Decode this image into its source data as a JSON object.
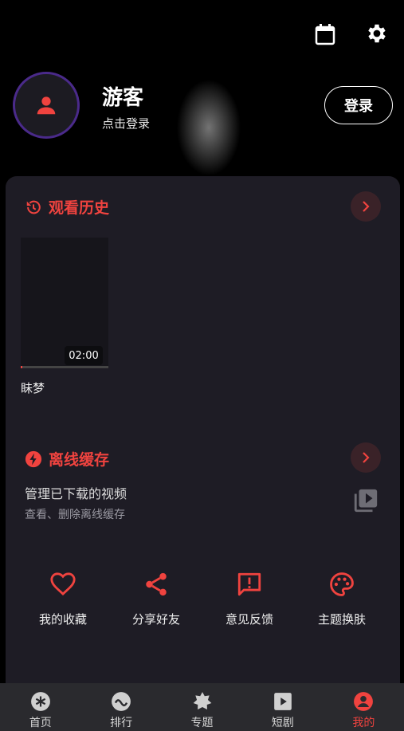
{
  "header": {
    "calendar_icon": "calendar-icon",
    "settings_icon": "gear-icon"
  },
  "profile": {
    "username": "游客",
    "subtitle": "点击登录",
    "login_label": "登录"
  },
  "history": {
    "title": "观看历史",
    "items": [
      {
        "title": "眛梦",
        "duration": "02:00",
        "progress": 0.02
      }
    ]
  },
  "offline": {
    "title": "离线缓存",
    "main_text": "管理已下载的视频",
    "sub_text": "查看、删除离线缓存"
  },
  "actions": [
    {
      "label": "我的收藏",
      "icon": "heart-icon"
    },
    {
      "label": "分享好友",
      "icon": "share-icon"
    },
    {
      "label": "意见反馈",
      "icon": "feedback-icon"
    },
    {
      "label": "主题换肤",
      "icon": "palette-icon"
    }
  ],
  "tabs": [
    {
      "label": "首页",
      "icon": "home-icon"
    },
    {
      "label": "排行",
      "icon": "ranking-icon"
    },
    {
      "label": "专题",
      "icon": "topic-icon"
    },
    {
      "label": "短剧",
      "icon": "play-icon"
    },
    {
      "label": "我的",
      "icon": "profile-icon",
      "active": true
    }
  ],
  "colors": {
    "accent": "#f0433f",
    "panel": "#1e1c25",
    "tabbar": "#2a2a2e"
  }
}
